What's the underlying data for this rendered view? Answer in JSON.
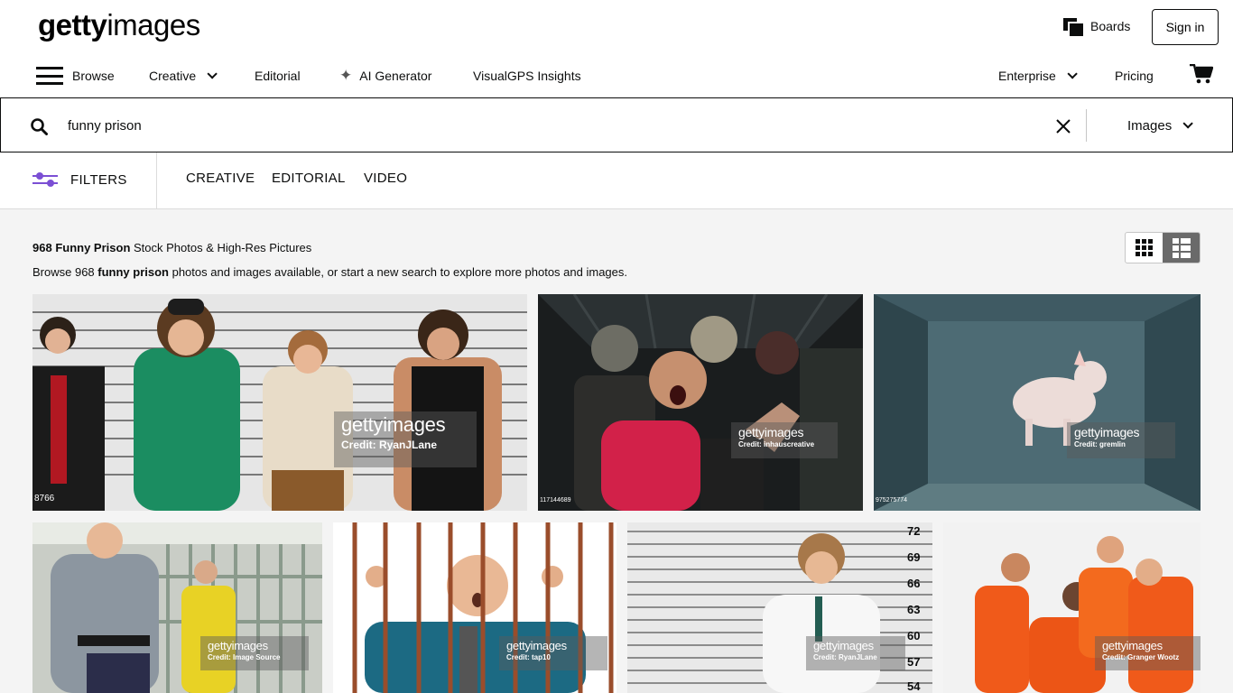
{
  "header": {
    "logo_bold": "getty",
    "logo_regular": "images",
    "boards_label": "Boards",
    "signin_label": "Sign in"
  },
  "nav": {
    "browse": "Browse",
    "creative": "Creative",
    "editorial": "Editorial",
    "ai_generator": "AI Generator",
    "visualgps": "VisualGPS Insights",
    "enterprise": "Enterprise",
    "pricing": "Pricing"
  },
  "search": {
    "value": "funny prison",
    "type_label": "Images"
  },
  "filters": {
    "label": "FILTERS",
    "tabs": [
      "CREATIVE",
      "EDITORIAL",
      "VIDEO"
    ]
  },
  "results": {
    "count": "968",
    "term_title": "Funny Prison",
    "heading_suffix": " Stock Photos & High-Res Pictures",
    "sub_prefix": "Browse 968 ",
    "sub_term": "funny prison",
    "sub_suffix": " photos and images available, or start a new search to explore more photos and images."
  },
  "images": [
    {
      "alt": "Mugshot lineup of four men",
      "wm_logo": "gettyimages",
      "credit": "Credit: RyanJLane",
      "id": "8766"
    },
    {
      "alt": "Woman screaming surrounded by zombies",
      "wm_logo": "gettyimages",
      "credit": "Credit: inhauscreative",
      "id": "117144689"
    },
    {
      "alt": "Pig floating in a cell",
      "wm_logo": "gettyimages",
      "credit": "Credit: gremlin",
      "id": "975275774"
    },
    {
      "alt": "Guard and inmate in yellow suit",
      "wm_logo": "gettyimages",
      "credit": "Credit: Image Source",
      "id": ""
    },
    {
      "alt": "Bald man behind bars",
      "wm_logo": "gettyimages",
      "credit": "Credit: tap10",
      "id": ""
    },
    {
      "alt": "Man in lab coat mugshot",
      "wm_logo": "gettyimages",
      "credit": "Credit: RyanJLane",
      "id": "",
      "heights": [
        "72",
        "69",
        "66",
        "63",
        "60",
        "57",
        "54"
      ]
    },
    {
      "alt": "Group in orange jumpsuits",
      "wm_logo": "gettyimages",
      "credit": "Credit: Granger Wootz",
      "id": ""
    }
  ],
  "colors": {
    "accent": "#7b4fd4",
    "text": "#0c0d0d",
    "content_bg": "#f4f4f4"
  }
}
